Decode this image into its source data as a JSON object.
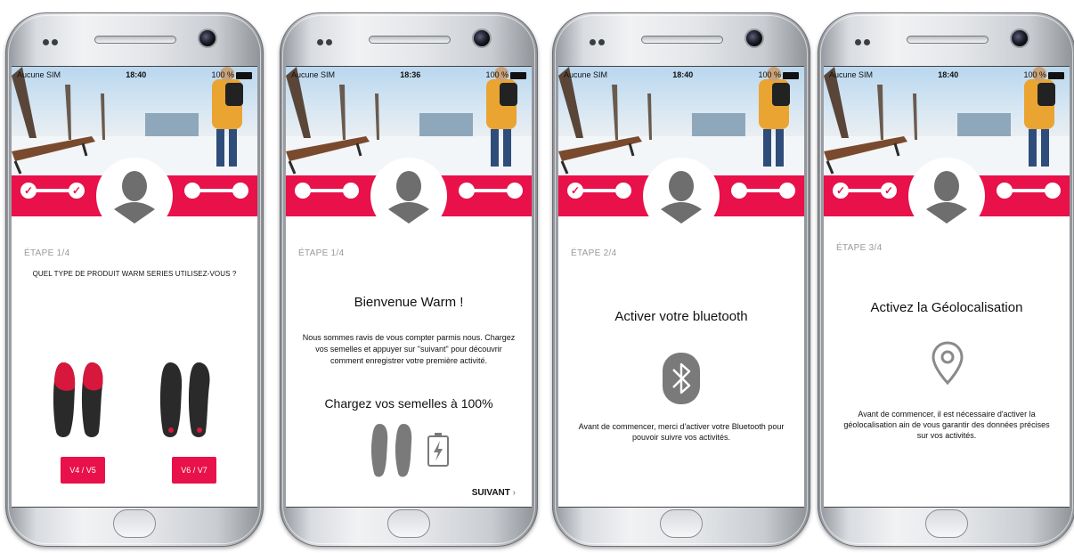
{
  "colors": {
    "accent": "#e8114a",
    "icon_grey": "#6e6e6e",
    "text": "#111111",
    "step_grey": "#9a9a9a"
  },
  "screens": [
    {
      "status": {
        "carrier": "Aucune SIM",
        "time": "18:40",
        "battery": "100 %"
      },
      "progress_done": [
        true,
        true,
        false,
        false
      ],
      "step": "ÉTAPE 1/4",
      "question": "QUEL TYPE DE PRODUIT WARM SERIES UTILISEZ-VOUS ?",
      "products": [
        {
          "label": "V4 / V5",
          "color": "red"
        },
        {
          "label": "V6 / V7",
          "color": "black"
        }
      ]
    },
    {
      "status": {
        "carrier": "Aucune SIM",
        "time": "18:36",
        "battery": "100 %"
      },
      "progress_done": [
        false,
        false,
        false,
        false
      ],
      "step": "ÉTAPE 1/4",
      "title": "Bienvenue Warm !",
      "body": "Nous sommes ravis de vous compter parmis nous. Chargez vos semelles et appuyer sur \"suivant\" pour découvrir comment enregistrer votre première activité.",
      "subtitle": "Chargez vos semelles à 100%",
      "icons": [
        "insoles-icon",
        "battery-charging-icon"
      ],
      "next": "SUIVANT"
    },
    {
      "status": {
        "carrier": "Aucune SIM",
        "time": "18:40",
        "battery": "100 %"
      },
      "progress_done": [
        true,
        false,
        false,
        false
      ],
      "step": "ÉTAPE 2/4",
      "title": "Activer votre bluetooth",
      "icons": [
        "bluetooth-icon"
      ],
      "body": "Avant de commencer, merci d'activer votre Bluetooth pour pouvoir suivre vos activités."
    },
    {
      "status": {
        "carrier": "Aucune SIM",
        "time": "18:40",
        "battery": "100 %"
      },
      "progress_done": [
        true,
        true,
        false,
        false
      ],
      "step": "ÉTAPE 3/4",
      "title": "Activez la Géolocalisation",
      "icons": [
        "location-pin-icon"
      ],
      "body": "Avant de commencer, il est nécessaire d'activer la géolocalisation ain de vous garantir des données précises sur vos activités."
    }
  ]
}
